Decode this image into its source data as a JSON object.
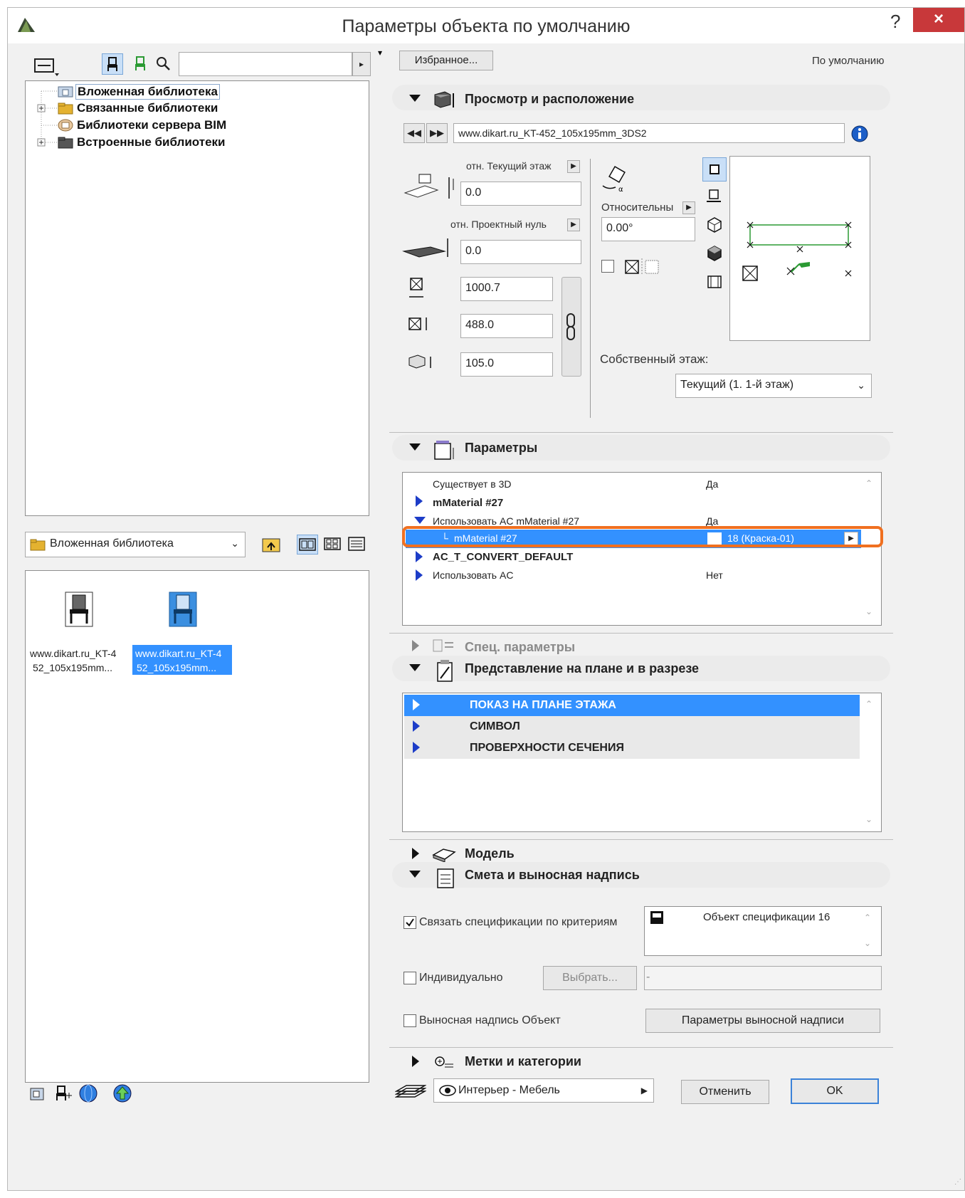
{
  "window": {
    "title": "Параметры объекта по умолчанию",
    "help": "?",
    "close": "×"
  },
  "left": {
    "tree": [
      {
        "label": "Вложенная библиотека"
      },
      {
        "label": "Связанные библиотеки"
      },
      {
        "label": "Библиотеки сервера BIM"
      },
      {
        "label": "Встроенные библиотеки"
      }
    ],
    "folder_select": "Вложенная библиотека",
    "items": [
      {
        "line1": "www.dikart.ru_KT-4",
        "line2": "52_105x195mm..."
      },
      {
        "line1": "www.dikart.ru_KT-4",
        "line2": "52_105x195mm..."
      }
    ]
  },
  "top": {
    "favorites": "Избранное...",
    "default_label": "По умолчанию"
  },
  "section_view": {
    "title": "Просмотр и расположение",
    "object_name": "www.dikart.ru_KT-452_105x195mm_3DS2",
    "rel_story_label": "отн. Текущий этаж",
    "rel_story_value": "0.0",
    "rel_zero_label": "отн. Проектный нуль",
    "rel_zero_value": "0.0",
    "width": "1000.7",
    "depth": "488.0",
    "height": "105.0",
    "relative_label": "Относительны",
    "angle": "0.00°",
    "home_story_label": "Собственный этаж:",
    "home_story_value": "Текущий (1. 1-й этаж)"
  },
  "section_params": {
    "title": "Параметры",
    "rows": [
      {
        "name": "Существует в 3D",
        "value": "Да"
      },
      {
        "name": "mMaterial #27",
        "value": ""
      },
      {
        "name": "Использовать AC mMaterial #27",
        "value": "Да"
      },
      {
        "name": "mMaterial #27",
        "value": "18 (Краска-01)"
      },
      {
        "name": "AC_T_CONVERT_DEFAULT",
        "value": ""
      },
      {
        "name": "Использовать AC",
        "value": "Нет"
      }
    ]
  },
  "section_spec": {
    "title": "Спец. параметры"
  },
  "section_plan": {
    "title": "Представление на плане и в разрезе",
    "rows": [
      "ПОКАЗ НА ПЛАНЕ ЭТАЖА",
      "СИМВОЛ",
      "ПРОВЕРХНОСТИ СЕЧЕНИЯ"
    ]
  },
  "section_model": {
    "title": "Модель"
  },
  "section_estimate": {
    "title": "Смета и выносная надпись",
    "link_label": "Связать спецификации по критериям",
    "spec_object": "Объект спецификации 16",
    "individual_label": "Индивидуально",
    "choose_btn": "Выбрать...",
    "individual_value": "-",
    "callout_label": "Выносная надпись Объект",
    "callout_btn": "Параметры выносной надписи"
  },
  "section_tags": {
    "title": "Метки и категории"
  },
  "bottom": {
    "layer": "Интерьер - Мебель",
    "cancel": "Отменить",
    "ok": "OK"
  },
  "colors": {
    "selection": "#3391ff",
    "highlight": "#f07020",
    "close_red": "#c8383a"
  }
}
